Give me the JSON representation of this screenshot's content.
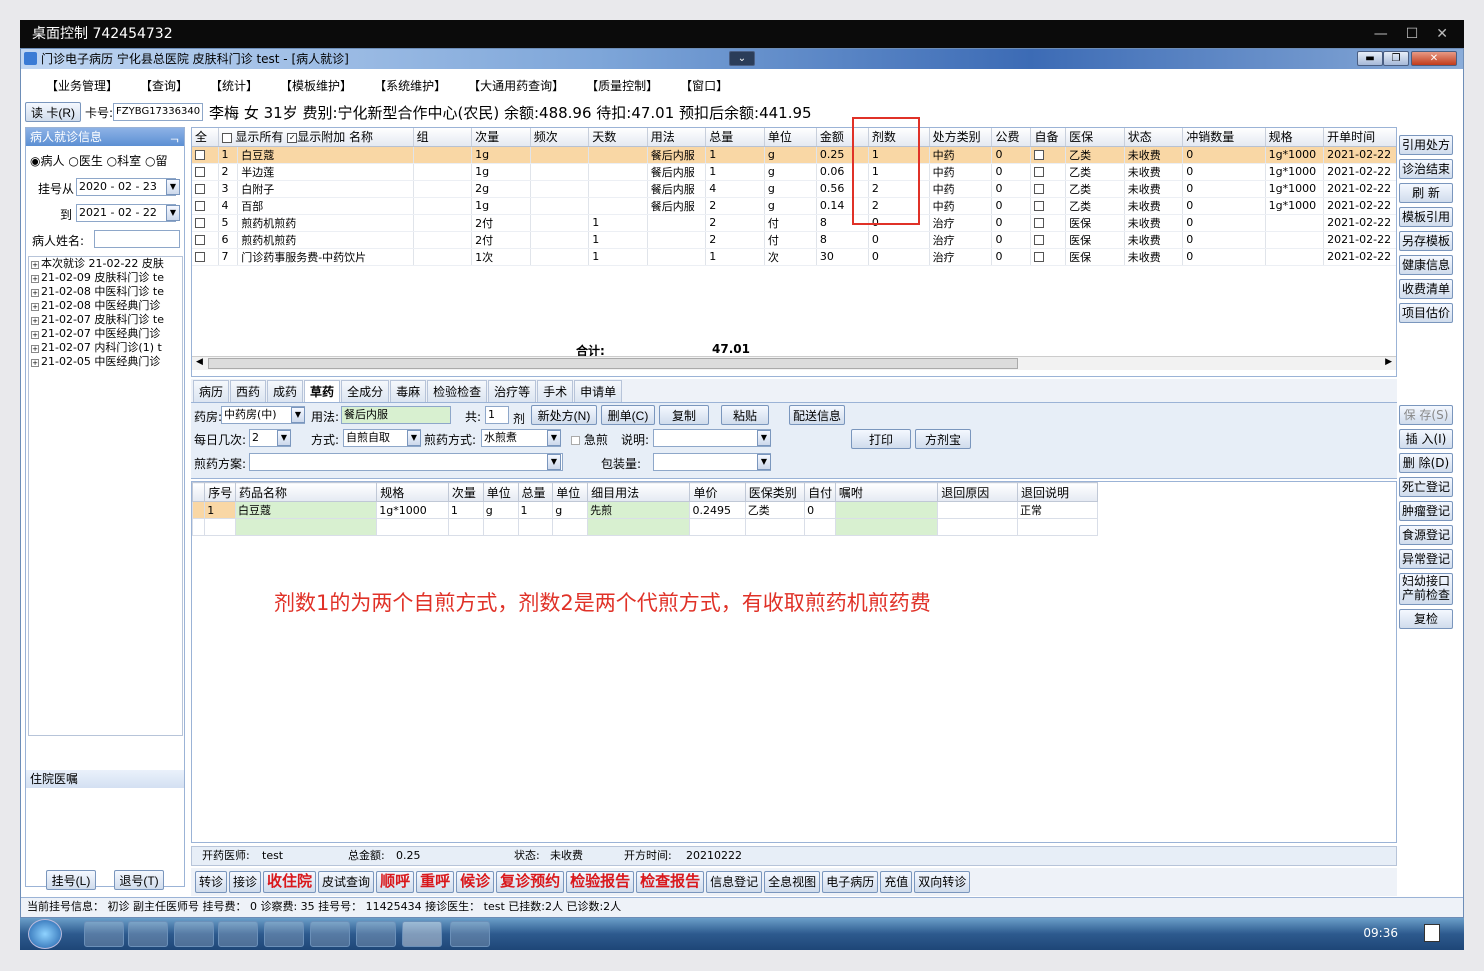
{
  "outer_window": {
    "title": "桌面控制 742454732",
    "controls": [
      "—",
      "☐",
      "✕"
    ]
  },
  "app": {
    "title": "门诊电子病历 宁化县总医院 皮肤科门诊 test - [病人就诊]",
    "menu": [
      "【业务管理】",
      "【查询】",
      "【统计】",
      "【模板维护】",
      "【系统维护】",
      "【大通用药查询】",
      "【质量控制】",
      "【窗口】"
    ]
  },
  "infobar": {
    "read_card": "读 卡(R)",
    "card_label": "卡号:",
    "card_value": "FZYBG17336340",
    "patient_line": "李梅 女 31岁 费别:宁化新型合作中心(农民) 余额:488.96 待扣:47.01 预扣后余额:441.95"
  },
  "left_panel": {
    "header": "病人就诊信息",
    "pin": "ᆨ",
    "radios": [
      "病人",
      "医生",
      "科室",
      "留"
    ],
    "reg_from_label": "挂号从",
    "reg_from": "2020 - 02 - 23",
    "reg_to_label": "到",
    "reg_to": "2021 - 02 - 22",
    "name_label": "病人姓名:",
    "tree": [
      "本次就诊 21-02-22 皮肤",
      "21-02-09 皮肤科门诊 te",
      "21-02-08 中医科门诊 te",
      "21-02-08 中医经典门诊",
      "21-02-07 皮肤科门诊 te",
      "21-02-07 中医经典门诊",
      "21-02-07 内科门诊(1) t",
      "21-02-05 中医经典门诊"
    ],
    "orders_header": "住院医嘱",
    "reg_button": "挂号(L)",
    "unreg_button": "退号(T)"
  },
  "grid": {
    "top_labels": {
      "all": "全",
      "show_all": "显示所有",
      "show_extra": "显示附加"
    },
    "columns": [
      "名称",
      "组",
      "次量",
      "频次",
      "天数",
      "用法",
      "总量",
      "单位",
      "金额",
      "剂数",
      "处方类别",
      "公费",
      "自备",
      "医保",
      "状态",
      "冲销数量",
      "规格",
      "开单时间"
    ],
    "rows": [
      [
        "1",
        "白豆蔻",
        "",
        "1g",
        "",
        "",
        "餐后内服",
        "1",
        "g",
        "0.25",
        "1",
        "中药",
        "0",
        "",
        "乙类",
        "未收费",
        "0",
        "1g*1000",
        "2021-02-22"
      ],
      [
        "2",
        "半边莲",
        "",
        "1g",
        "",
        "",
        "餐后内服",
        "1",
        "g",
        "0.06",
        "1",
        "中药",
        "0",
        "",
        "乙类",
        "未收费",
        "0",
        "1g*1000",
        "2021-02-22"
      ],
      [
        "3",
        "白附子",
        "",
        "2g",
        "",
        "",
        "餐后内服",
        "4",
        "g",
        "0.56",
        "2",
        "中药",
        "0",
        "",
        "乙类",
        "未收费",
        "0",
        "1g*1000",
        "2021-02-22"
      ],
      [
        "4",
        "百部",
        "",
        "1g",
        "",
        "",
        "餐后内服",
        "2",
        "g",
        "0.14",
        "2",
        "中药",
        "0",
        "",
        "乙类",
        "未收费",
        "0",
        "1g*1000",
        "2021-02-22"
      ],
      [
        "5",
        "煎药机煎药",
        "",
        "2付",
        "",
        "1",
        "",
        "2",
        "付",
        "8",
        "0",
        "治疗",
        "0",
        "",
        "医保",
        "未收费",
        "0",
        "",
        "2021-02-22"
      ],
      [
        "6",
        "煎药机煎药",
        "",
        "2付",
        "",
        "1",
        "",
        "2",
        "付",
        "8",
        "0",
        "治疗",
        "0",
        "",
        "医保",
        "未收费",
        "0",
        "",
        "2021-02-22"
      ],
      [
        "7",
        "门诊药事服务费-中药饮片",
        "",
        "1次",
        "",
        "1",
        "",
        "1",
        "次",
        "30",
        "0",
        "治疗",
        "0",
        "",
        "医保",
        "未收费",
        "0",
        "",
        "2021-02-22"
      ]
    ],
    "total_label": "合计:",
    "total_value": "47.01"
  },
  "right_buttons_top": [
    "引用处方",
    "诊治结束",
    "刷 新",
    "模板引用",
    "另存模板",
    "健康信息",
    "收费清单",
    "项目估价"
  ],
  "right_buttons_bottom": [
    "保 存(S)",
    "插 入(I)",
    "删 除(D)",
    "死亡登记",
    "肿瘤登记",
    "食源登记",
    "异常登记",
    "妇幼接口\n产前检查",
    "复检"
  ],
  "tabs": [
    "病历",
    "西药",
    "成药",
    "草药",
    "全成分",
    "毒麻",
    "检验检查",
    "治疗等",
    "手术",
    "申请单"
  ],
  "form": {
    "pharmacy_label": "药房:",
    "pharmacy": "中药房(中)",
    "usage_label": "用法:",
    "usage": "餐后内服",
    "total_label": "共:",
    "total": "1",
    "dose_unit": "剂",
    "new_rx": "新处方(N)",
    "del_rx": "删单(C)",
    "copy": "复制",
    "paste": "粘贴",
    "dispense": "配送信息",
    "daily_label": "每日几次:",
    "daily": "2",
    "method_label": "方式:",
    "method": "自煎自取",
    "decoct_label": "煎药方式:",
    "decoct": "水煎煮",
    "urgent": "急煎",
    "desc_label": "说明:",
    "print": "打印",
    "prescription_tool": "方剂宝",
    "plan_label": "煎药方案:",
    "pack_label": "包装量:"
  },
  "detail": {
    "columns": [
      "序号",
      "药品名称",
      "规格",
      "次量",
      "单位",
      "总量",
      "单位",
      "细目用法",
      "单价",
      "医保类别",
      "自付",
      "嘱咐",
      "退回原因",
      "退回说明"
    ],
    "rows": [
      [
        "1",
        "白豆蔻",
        "1g*1000",
        "1",
        "g",
        "1",
        "g",
        "先煎",
        "0.2495",
        "乙类",
        "0",
        "",
        "",
        "正常"
      ]
    ]
  },
  "note": "剂数1的为两个自煎方式，剂数2是两个代煎方式，有收取煎药机煎药费",
  "status": {
    "doctor_label": "开药医师:",
    "doctor": "test",
    "amount_label": "总金额:",
    "amount": "0.25",
    "state_label": "状态:",
    "state": "未收费",
    "time_label": "开方时间:",
    "time": "20210222"
  },
  "action_buttons": [
    {
      "label": "转诊",
      "red": false
    },
    {
      "label": "接诊",
      "red": false
    },
    {
      "label": "收住院",
      "red": true
    },
    {
      "label": "皮试查询",
      "red": false
    },
    {
      "label": "顺呼",
      "red": true
    },
    {
      "label": "重呼",
      "red": true
    },
    {
      "label": "候诊",
      "red": true
    },
    {
      "label": "复诊预约",
      "red": true
    },
    {
      "label": "检验报告",
      "red": true
    },
    {
      "label": "检查报告",
      "red": true
    },
    {
      "label": "信息登记",
      "red": false
    },
    {
      "label": "全息视图",
      "red": false
    },
    {
      "label": "电子病历",
      "red": false
    },
    {
      "label": "充值",
      "red": false
    },
    {
      "label": "双向转诊",
      "red": false
    }
  ],
  "footer": "当前挂号信息： 初诊 副主任医师号 挂号费： 0 诊察费: 35 挂号号： 11425434 接诊医生： test 已挂数:2人 已诊数:2人",
  "taskbar": {
    "time": "09:36"
  }
}
